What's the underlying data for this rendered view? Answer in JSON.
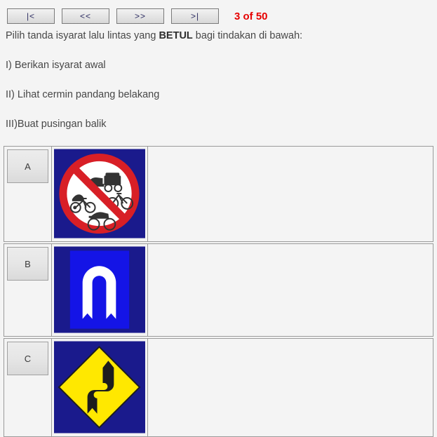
{
  "nav": {
    "buttons": [
      {
        "name": "first-button",
        "label": "|<"
      },
      {
        "name": "previous-button",
        "label": "<<"
      },
      {
        "name": "next-button",
        "label": ">>"
      },
      {
        "name": "last-button",
        "label": ">|"
      }
    ],
    "counter": "3 of 50",
    "counter_color": "#e60000"
  },
  "question": {
    "prompt_before": "Pilih tanda isyarat lalu lintas yang ",
    "prompt_emphasis": "BETUL",
    "prompt_after": " bagi tindakan di bawah:",
    "steps": [
      "I) Berikan isyarat awal",
      "II) Lihat cermin pandang belakang",
      "III)Buat pusingan balik"
    ]
  },
  "options": [
    {
      "letter": "A",
      "sign_name": "no-slow-vehicles-sign",
      "sign_description": "Prohibition sign: bullock cart, bicycle, trishaw and motorcycle in a red circle with diagonal slash on navy background",
      "background_color": "#1a1a8c",
      "accent_color": "#d81f26"
    },
    {
      "letter": "B",
      "sign_name": "u-turn-sign",
      "sign_description": "White U-turn arrow on bright blue rectangle with navy border",
      "background_color": "#1a1a8c",
      "accent_color": "#1414e6"
    },
    {
      "letter": "C",
      "sign_name": "double-bend-warning-sign",
      "sign_description": "Yellow diamond warning sign with black S-shaped double bend arrow on navy background",
      "background_color": "#1a1a8c",
      "accent_color": "#ffe800"
    }
  ],
  "page": {
    "background_color": "#f4f4f4",
    "text_color": "#474747"
  }
}
